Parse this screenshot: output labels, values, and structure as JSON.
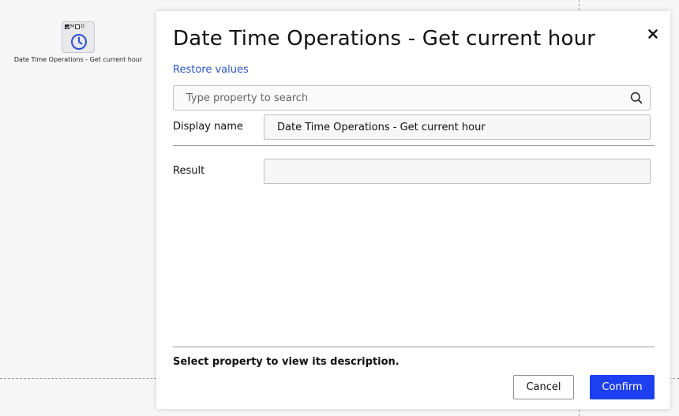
{
  "canvas": {
    "node": {
      "flags": [
        {
          "label": "M",
          "checked": true
        },
        {
          "label": "D",
          "checked": false
        }
      ],
      "icon": "clock-icon",
      "caption": "Date Time Operations - Get current hour"
    }
  },
  "dialog": {
    "title": "Date Time Operations - Get current hour",
    "close_icon": "close-icon",
    "restore_label": "Restore values",
    "search": {
      "placeholder": "Type property to search",
      "value": "",
      "icon": "search-icon"
    },
    "properties": [
      {
        "label": "Display name",
        "value": "Date Time Operations - Get current hour"
      },
      {
        "label": "Result",
        "value": ""
      }
    ],
    "description": "Select property to view its description.",
    "buttons": {
      "cancel": "Cancel",
      "confirm": "Confirm"
    }
  },
  "colors": {
    "accent": "#1d3ff0",
    "link": "#2d55c4",
    "icon_blue": "#2a4fd6"
  }
}
